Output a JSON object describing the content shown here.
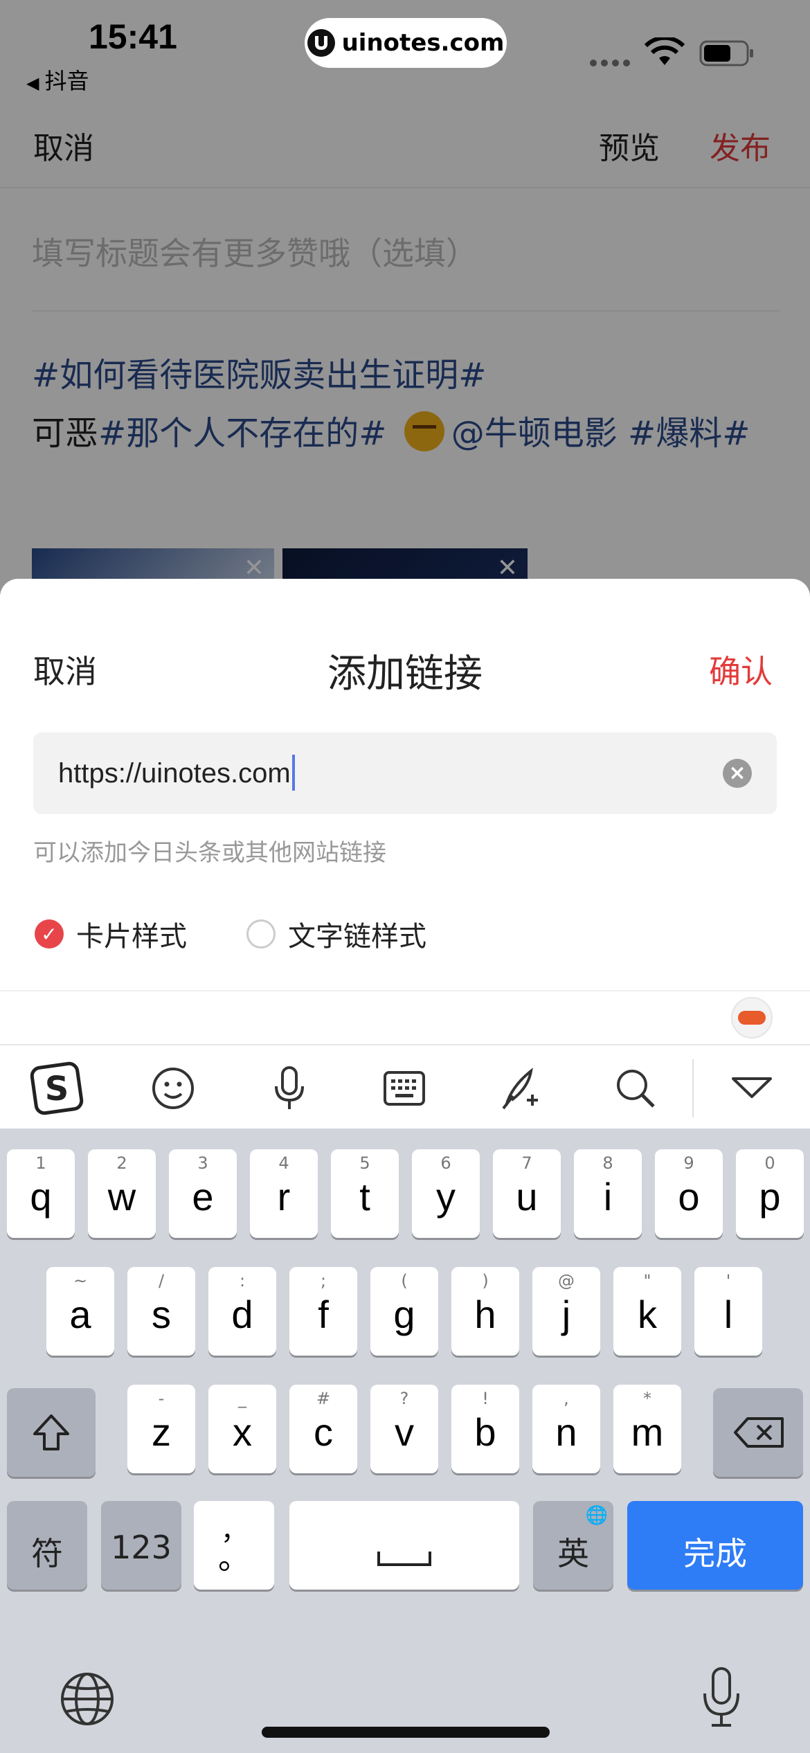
{
  "status_bar": {
    "time": "15:41",
    "back_app": "抖音",
    "url": "uinotes.com"
  },
  "editor": {
    "cancel": "取消",
    "preview": "预览",
    "publish": "发布",
    "title_placeholder": "填写标题会有更多赞哦（选填）",
    "body": {
      "line1_tag": "#如何看待医院贩卖出生证明#",
      "line2_plain": "可恶",
      "line2_tag1": "#那个人不存在的#",
      "line2_mention": "@牛顿电影",
      "line2_tag2": "#爆料#"
    }
  },
  "link_sheet": {
    "cancel": "取消",
    "title": "添加链接",
    "confirm": "确认",
    "url_value": "https://uinotes.com",
    "hint": "可以添加今日头条或其他网站链接",
    "style_options": [
      {
        "label": "卡片样式",
        "selected": true
      },
      {
        "label": "文字链样式",
        "selected": false
      }
    ]
  },
  "keyboard_toolbar": {
    "icons": [
      "sogou-logo-icon",
      "emoji-icon",
      "microphone-icon",
      "keyboard-icon",
      "handwriting-icon",
      "search-icon",
      "collapse-icon"
    ]
  },
  "keyboard": {
    "row1": [
      {
        "k": "q",
        "h": "1"
      },
      {
        "k": "w",
        "h": "2"
      },
      {
        "k": "e",
        "h": "3"
      },
      {
        "k": "r",
        "h": "4"
      },
      {
        "k": "t",
        "h": "5"
      },
      {
        "k": "y",
        "h": "6"
      },
      {
        "k": "u",
        "h": "7"
      },
      {
        "k": "i",
        "h": "8"
      },
      {
        "k": "o",
        "h": "9"
      },
      {
        "k": "p",
        "h": "0"
      }
    ],
    "row2": [
      {
        "k": "a",
        "h": "~"
      },
      {
        "k": "s",
        "h": "/"
      },
      {
        "k": "d",
        "h": ":"
      },
      {
        "k": "f",
        "h": ";"
      },
      {
        "k": "g",
        "h": "("
      },
      {
        "k": "h",
        "h": ")"
      },
      {
        "k": "j",
        "h": "@"
      },
      {
        "k": "k",
        "h": "\""
      },
      {
        "k": "l",
        "h": "'"
      }
    ],
    "row3": [
      {
        "k": "z",
        "h": "-"
      },
      {
        "k": "x",
        "h": "_"
      },
      {
        "k": "c",
        "h": "#"
      },
      {
        "k": "v",
        "h": "?"
      },
      {
        "k": "b",
        "h": "!"
      },
      {
        "k": "n",
        "h": ","
      },
      {
        "k": "m",
        "h": "*"
      }
    ],
    "symbols": "符",
    "numbers": "123",
    "punct_top": "，",
    "punct_bottom": "。",
    "lang": "英",
    "done": "完成"
  },
  "colors": {
    "accent_red": "#e33a3a",
    "hashtag_blue": "#2c4a8c",
    "done_blue": "#2e7cf6",
    "keyboard_bg": "#d1d4db"
  }
}
